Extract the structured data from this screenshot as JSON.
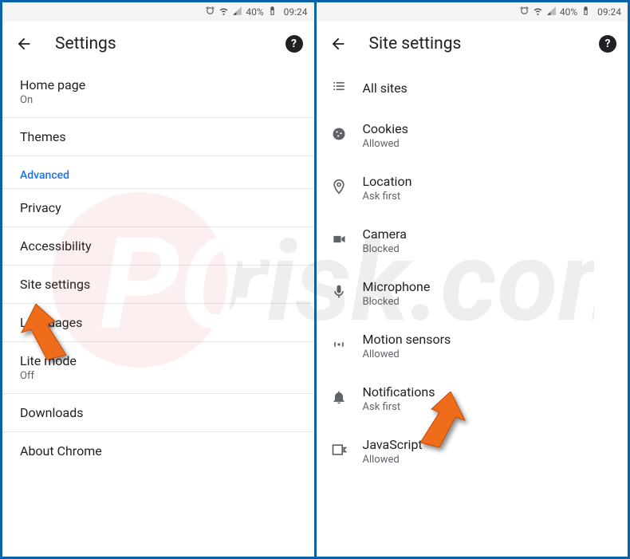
{
  "status": {
    "battery_pct": "40%",
    "time": "09:24"
  },
  "left": {
    "title": "Settings",
    "items": [
      {
        "label": "Home page",
        "sub": "On"
      },
      {
        "label": "Themes"
      }
    ],
    "advanced_label": "Advanced",
    "advanced_items": [
      {
        "label": "Privacy"
      },
      {
        "label": "Accessibility"
      },
      {
        "label": "Site settings"
      },
      {
        "label": "Languages"
      },
      {
        "label": "Lite mode",
        "sub": "Off"
      },
      {
        "label": "Downloads"
      },
      {
        "label": "About Chrome"
      }
    ]
  },
  "right": {
    "title": "Site settings",
    "items": [
      {
        "icon": "list",
        "label": "All sites"
      },
      {
        "icon": "cookie",
        "label": "Cookies",
        "sub": "Allowed"
      },
      {
        "icon": "location",
        "label": "Location",
        "sub": "Ask first"
      },
      {
        "icon": "camera",
        "label": "Camera",
        "sub": "Blocked"
      },
      {
        "icon": "mic",
        "label": "Microphone",
        "sub": "Blocked"
      },
      {
        "icon": "motion",
        "label": "Motion sensors",
        "sub": "Allowed"
      },
      {
        "icon": "bell",
        "label": "Notifications",
        "sub": "Ask first"
      },
      {
        "icon": "js",
        "label": "JavaScript",
        "sub": "Allowed"
      }
    ]
  }
}
